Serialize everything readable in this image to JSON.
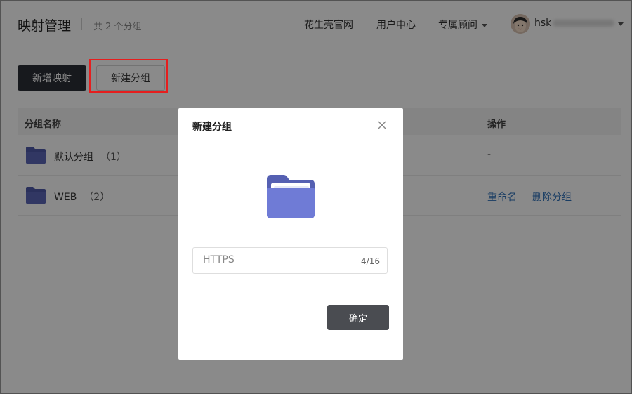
{
  "header": {
    "title": "映射管理",
    "group_count": "共 2 个分组",
    "nav": [
      {
        "label": "花生壳官网"
      },
      {
        "label": "用户中心"
      },
      {
        "label": "专属顾问"
      }
    ],
    "user": {
      "name_visible": "hsk"
    }
  },
  "toolbar": {
    "add_mapping_label": "新增映射",
    "new_group_label": "新建分组"
  },
  "table": {
    "columns": {
      "name": "分组名称",
      "ops": "操作"
    },
    "rows": [
      {
        "name": "默认分组",
        "count": "（1）",
        "ops_placeholder": "-"
      },
      {
        "name": "WEB",
        "count": "（2）",
        "rename": "重命名",
        "delete": "删除分组"
      }
    ]
  },
  "modal": {
    "title": "新建分组",
    "input_value": "HTTPS",
    "counter": "4/16",
    "confirm_label": "确定"
  },
  "colors": {
    "folder": "#6f7bd6",
    "folder_dark": "#4f5aa8",
    "link": "#2d6fb8",
    "highlight": "#e61e1e"
  },
  "icons": [
    "folder-icon",
    "close-icon",
    "chevron-down-icon",
    "avatar"
  ]
}
